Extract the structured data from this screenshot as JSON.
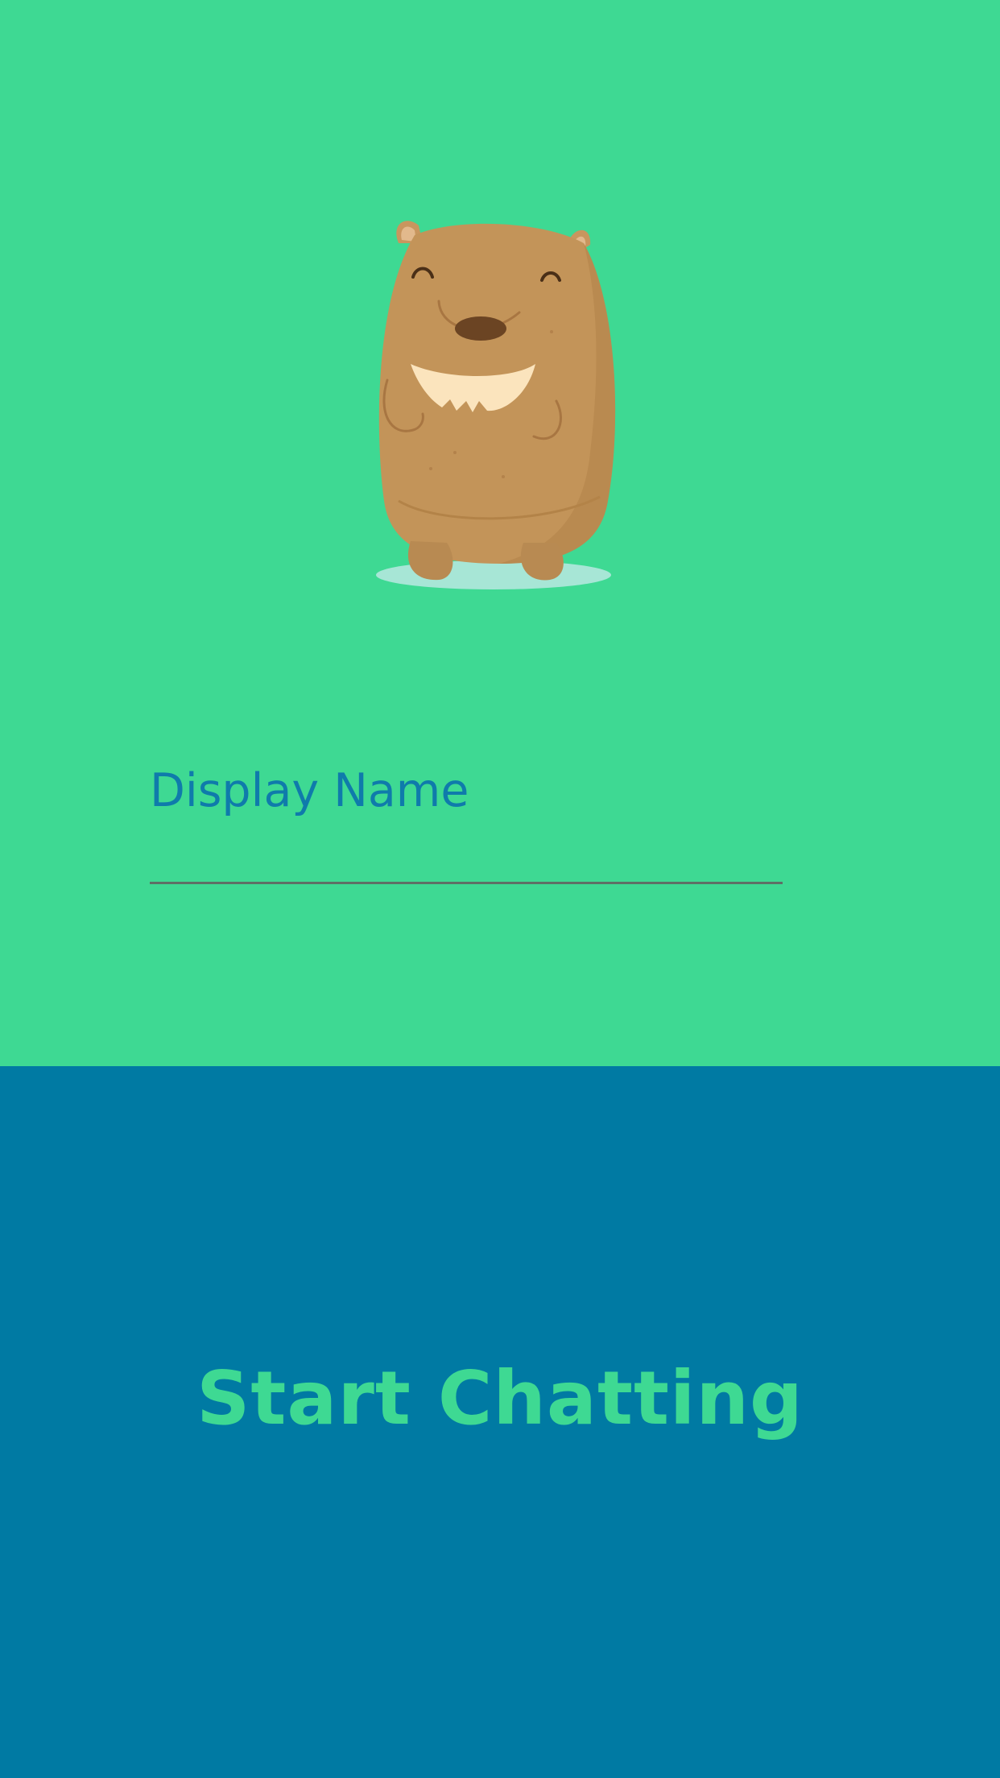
{
  "login": {
    "display_name_label": "Display Name",
    "display_name_value": "",
    "start_button_label": "Start Chatting"
  },
  "colors": {
    "top_background": "#3ed993",
    "bottom_background": "#007aa3",
    "label_color": "#0f7bab",
    "button_text": "#3ed993"
  },
  "icons": {
    "mascot": "wombat-mascot-icon"
  }
}
